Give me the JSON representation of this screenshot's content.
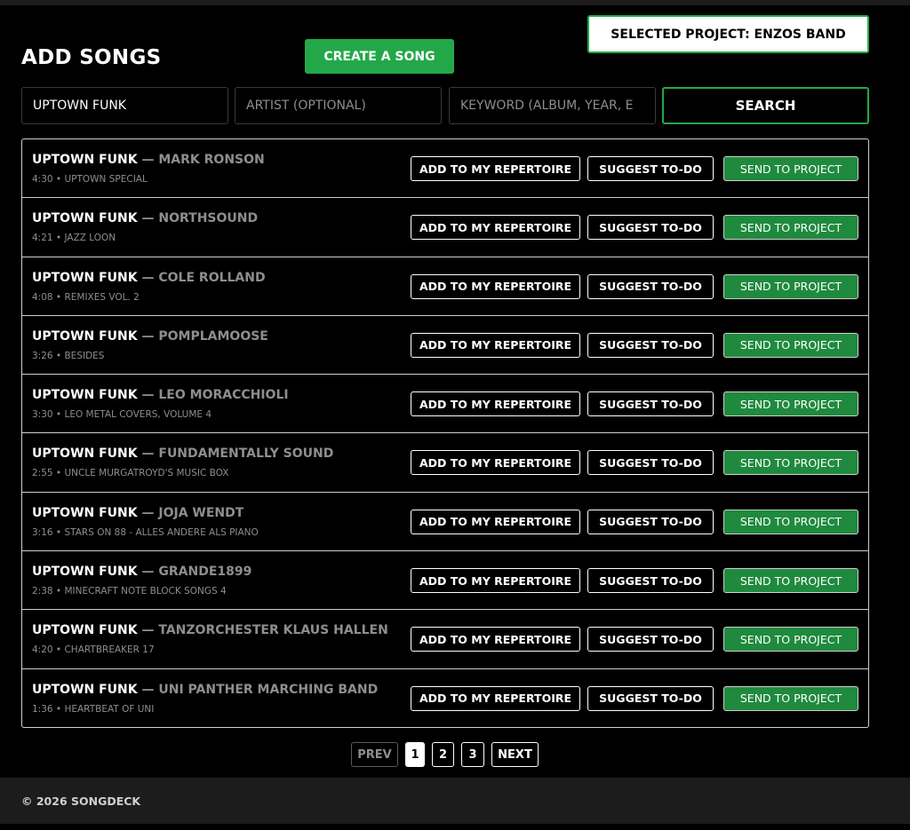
{
  "header": {
    "title": "ADD SONGS",
    "create_label": "CREATE A SONG",
    "selected_project": "SELECTED PROJECT: ENZOS BAND"
  },
  "search": {
    "title_value": "UPTOWN FUNK",
    "title_placeholder": "",
    "artist_value": "",
    "artist_placeholder": "ARTIST (OPTIONAL)",
    "keyword_value": "",
    "keyword_placeholder": "KEYWORD (ALBUM, YEAR, E",
    "button_label": "SEARCH"
  },
  "actions": {
    "add_label": "ADD TO MY REPERTOIRE",
    "suggest_label": "SUGGEST TO-DO",
    "send_label": "SEND TO PROJECT"
  },
  "results": [
    {
      "title": "UPTOWN FUNK",
      "artist": "MARK RONSON",
      "duration": "4:30",
      "album": "UPTOWN SPECIAL"
    },
    {
      "title": "UPTOWN FUNK",
      "artist": "NORTHSOUND",
      "duration": "4:21",
      "album": "JAZZ LOON"
    },
    {
      "title": "UPTOWN FUNK",
      "artist": "COLE ROLLAND",
      "duration": "4:08",
      "album": "REMIXES VOL. 2"
    },
    {
      "title": "UPTOWN FUNK",
      "artist": "POMPLAMOOSE",
      "duration": "3:26",
      "album": "BESIDES"
    },
    {
      "title": "UPTOWN FUNK",
      "artist": "LEO MORACCHIOLI",
      "duration": "3:30",
      "album": "LEO METAL COVERS, VOLUME 4"
    },
    {
      "title": "UPTOWN FUNK",
      "artist": "FUNDAMENTALLY SOUND",
      "duration": "2:55",
      "album": "UNCLE MURGATROYD'S MUSIC BOX"
    },
    {
      "title": "UPTOWN FUNK",
      "artist": "JOJA WENDT",
      "duration": "3:16",
      "album": "STARS ON 88 - ALLES ANDERE ALS PIANO"
    },
    {
      "title": "UPTOWN FUNK",
      "artist": "GRANDE1899",
      "duration": "2:38",
      "album": "MINECRAFT NOTE BLOCK SONGS 4"
    },
    {
      "title": "UPTOWN FUNK",
      "artist": "TANZORCHESTER KLAUS HALLEN",
      "duration": "4:20",
      "album": "CHARTBREAKER 17"
    },
    {
      "title": "UPTOWN FUNK",
      "artist": "UNI PANTHER MARCHING BAND",
      "duration": "1:36",
      "album": "HEARTBEAT OF UNI"
    }
  ],
  "separators": {
    "artist": " — ",
    "meta": " • "
  },
  "pagination": {
    "prev": "PREV",
    "pages": [
      "1",
      "2",
      "3"
    ],
    "next": "NEXT",
    "current": "1"
  },
  "footer": {
    "text": "© 2026 SONGDECK"
  },
  "colors": {
    "accent": "#23a849",
    "send_button": "#1f8a3e",
    "muted_text": "#8e8e8e",
    "background": "#000000"
  }
}
